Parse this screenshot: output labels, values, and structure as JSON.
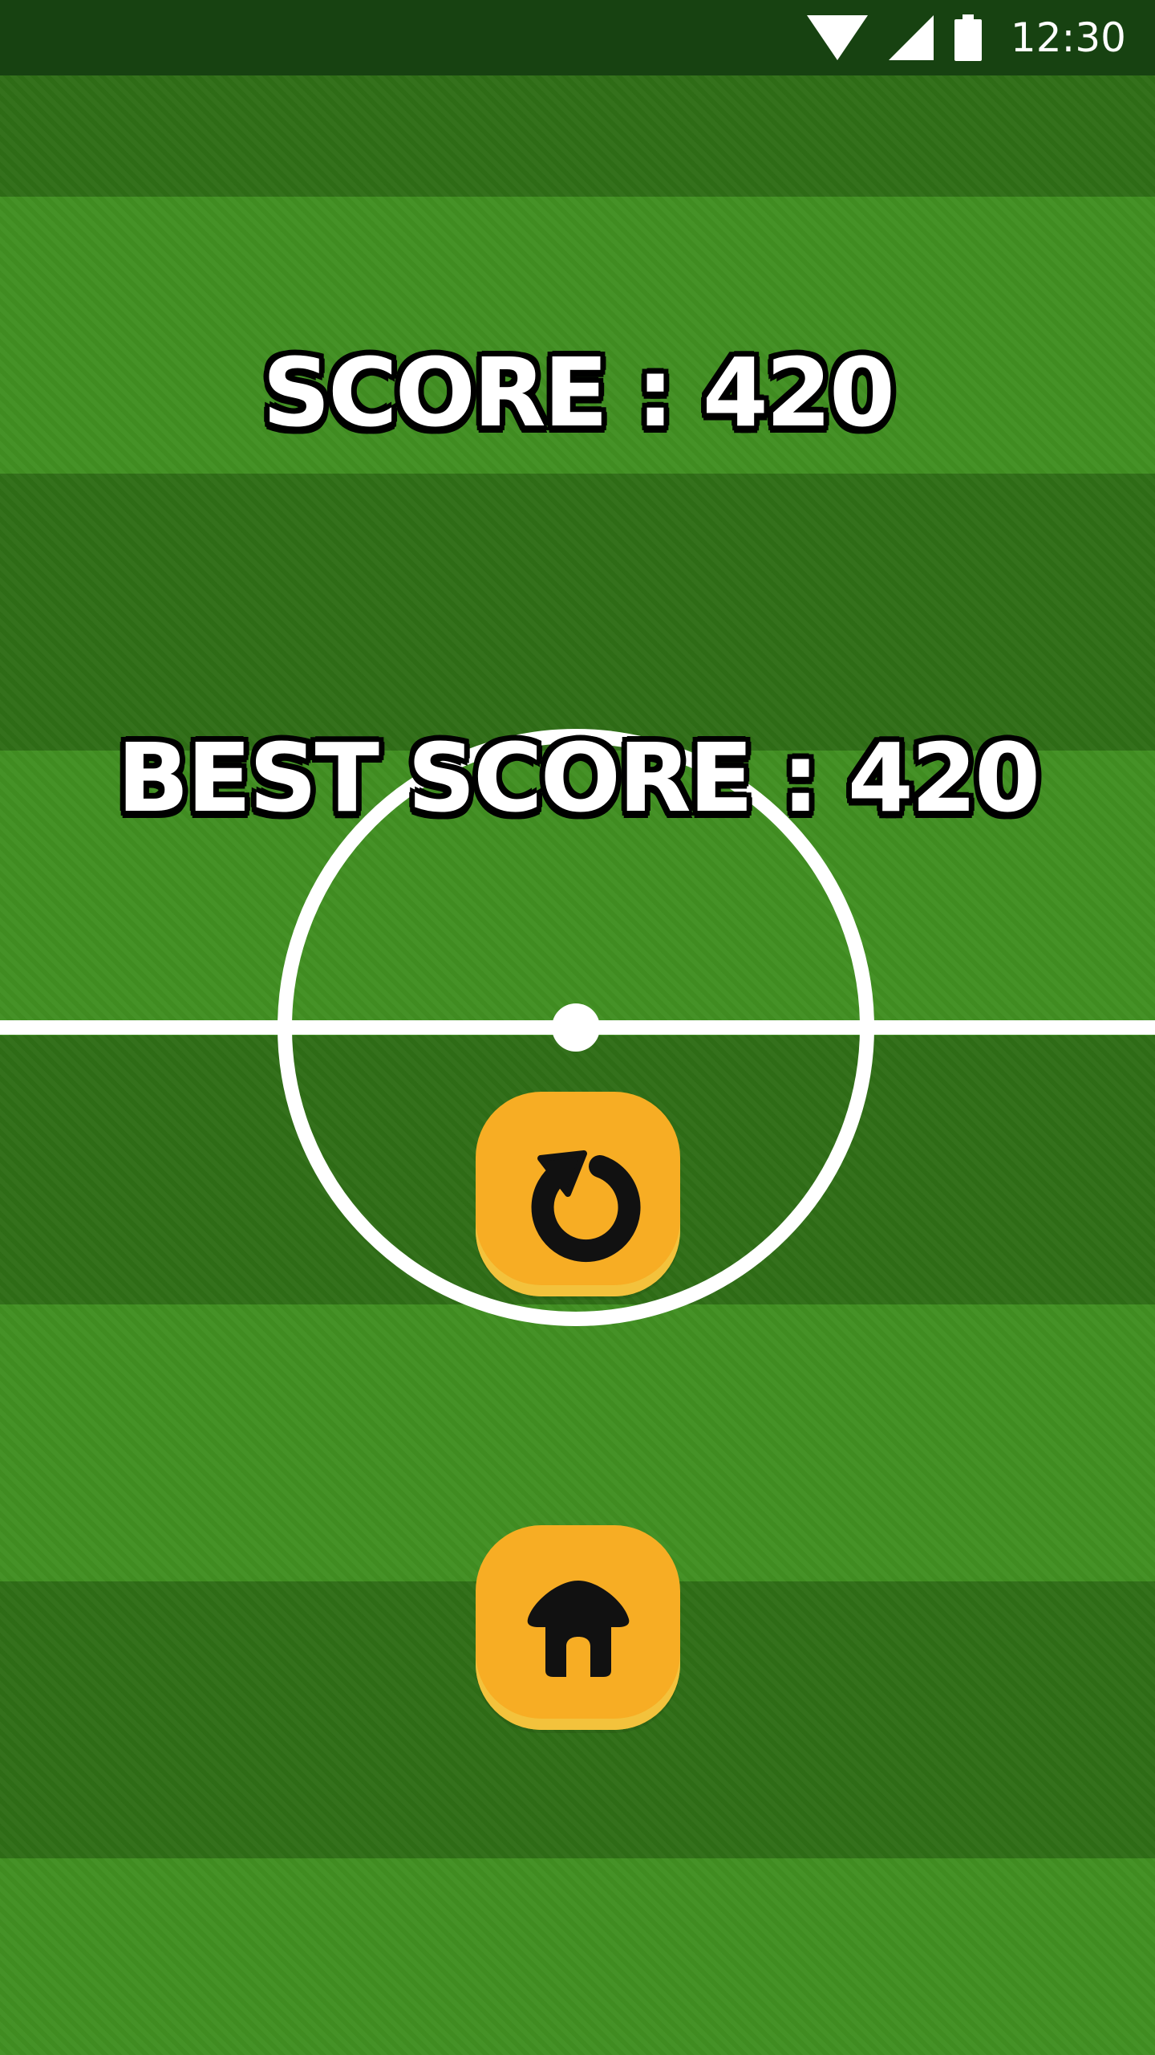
{
  "status_bar": {
    "time": "12:30",
    "icons": [
      "wifi-icon",
      "cellular-signal-icon",
      "battery-icon"
    ]
  },
  "game_over": {
    "score_line": "SCORE : 420",
    "best_score_line": "BEST SCORE : 420",
    "score": 420,
    "best_score": 420
  },
  "buttons": {
    "replay_icon": "replay-icon",
    "home_icon": "home-icon"
  },
  "colors": {
    "grass_dark": "#2f6e17",
    "grass_light": "#418f22",
    "status_bar": "#174211",
    "button_fill": "#f7ad24",
    "text_fill": "#ffffff",
    "text_outline": "#000000"
  }
}
